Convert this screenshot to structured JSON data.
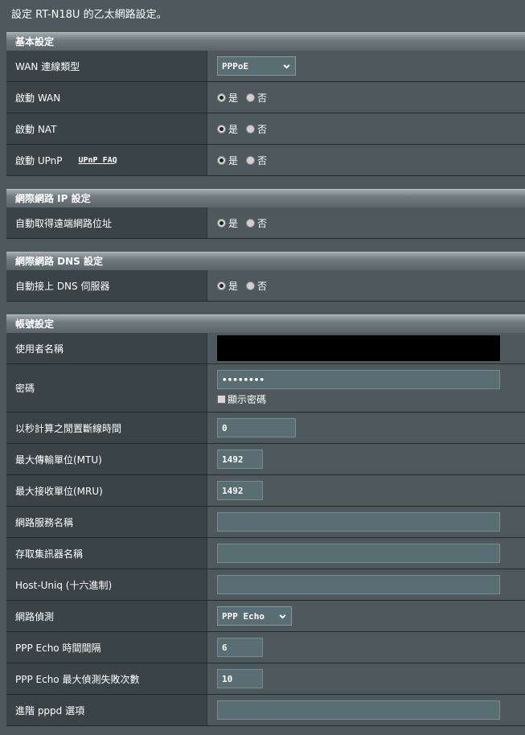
{
  "page_title": "設定 RT-N18U 的乙太網路設定。",
  "radio": {
    "yes": "是",
    "no": "否"
  },
  "basic": {
    "header": "基本設定",
    "wan_type_label": "WAN 連線類型",
    "wan_type_value": "PPPoE",
    "enable_wan_label": "啟動 WAN",
    "enable_nat_label": "啟動 NAT",
    "enable_upnp_label": "啟動 UPnP",
    "upnp_faq_link": "UPnP  FAQ"
  },
  "wan_ip": {
    "header": "網際網路 IP 設定",
    "auto_ip_label": "自動取得遠端網路位址"
  },
  "wan_dns": {
    "header": "網際網路 DNS 設定",
    "auto_dns_label": "自動接上 DNS 伺服器"
  },
  "account": {
    "header": "帳號設定",
    "username_label": "使用者名稱",
    "username_value": "",
    "password_label": "密碼",
    "password_value": "••••••••",
    "show_password_label": "顯示密碼",
    "idle_label": "以秒計算之閒置斷線時間",
    "idle_value": "0",
    "mtu_label": "最大傳輸單位(MTU)",
    "mtu_value": "1492",
    "mru_label": "最大接收單位(MRU)",
    "mru_value": "1492",
    "service_name_label": "網路服務名稱",
    "service_name_value": "",
    "ac_name_label": "存取集訊器名稱",
    "ac_name_value": "",
    "host_uniq_label": "Host-Uniq (十六進制)",
    "host_uniq_value": "",
    "detection_label": "網路偵測",
    "detection_value": "PPP Echo",
    "echo_interval_label": "PPP Echo 時間間隔",
    "echo_interval_value": "6",
    "echo_fail_label": "PPP Echo 最大偵測失敗次數",
    "echo_fail_value": "10",
    "pppd_label": "進階 pppd 選項",
    "pppd_value": ""
  }
}
